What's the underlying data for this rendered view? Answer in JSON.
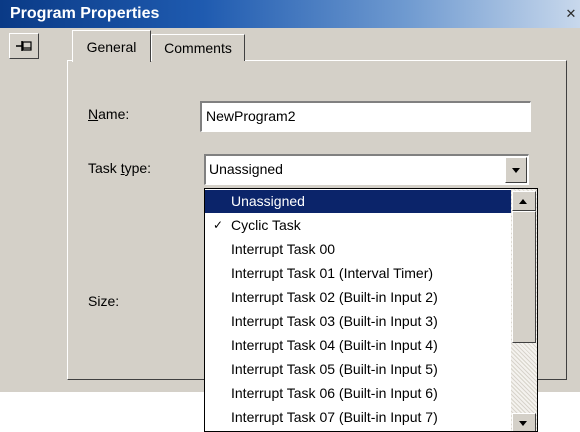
{
  "window": {
    "title": "Program Properties",
    "close_glyph": "✕"
  },
  "pin_button": {
    "icon": "pushpin-icon"
  },
  "tabs": [
    {
      "label": "General",
      "active": true
    },
    {
      "label": "Comments",
      "active": false
    }
  ],
  "form": {
    "name_label": "Name:",
    "name_value": "NewProgram2",
    "task_type_label": "Task type:",
    "task_type_value": "Unassigned",
    "size_label": "Size:"
  },
  "dropdown": {
    "items": [
      {
        "label": "Unassigned",
        "selected": true,
        "checked": false
      },
      {
        "label": "Cyclic Task",
        "selected": false,
        "checked": true
      },
      {
        "label": "Interrupt Task 00",
        "selected": false,
        "checked": false
      },
      {
        "label": "Interrupt Task 01 (Interval Timer)",
        "selected": false,
        "checked": false
      },
      {
        "label": "Interrupt Task 02 (Built-in Input 2)",
        "selected": false,
        "checked": false
      },
      {
        "label": "Interrupt Task 03 (Built-in Input 3)",
        "selected": false,
        "checked": false
      },
      {
        "label": "Interrupt Task 04 (Built-in Input 4)",
        "selected": false,
        "checked": false
      },
      {
        "label": "Interrupt Task 05 (Built-in Input 5)",
        "selected": false,
        "checked": false
      },
      {
        "label": "Interrupt Task 06 (Built-in Input 6)",
        "selected": false,
        "checked": false
      },
      {
        "label": "Interrupt Task 07 (Built-in Input 7)",
        "selected": false,
        "checked": false
      }
    ],
    "check_glyph": "✓"
  },
  "colors": {
    "titlebar_start": "#0a3a86",
    "selection": "#0b246a",
    "dialog_face": "#d4d0c8"
  }
}
